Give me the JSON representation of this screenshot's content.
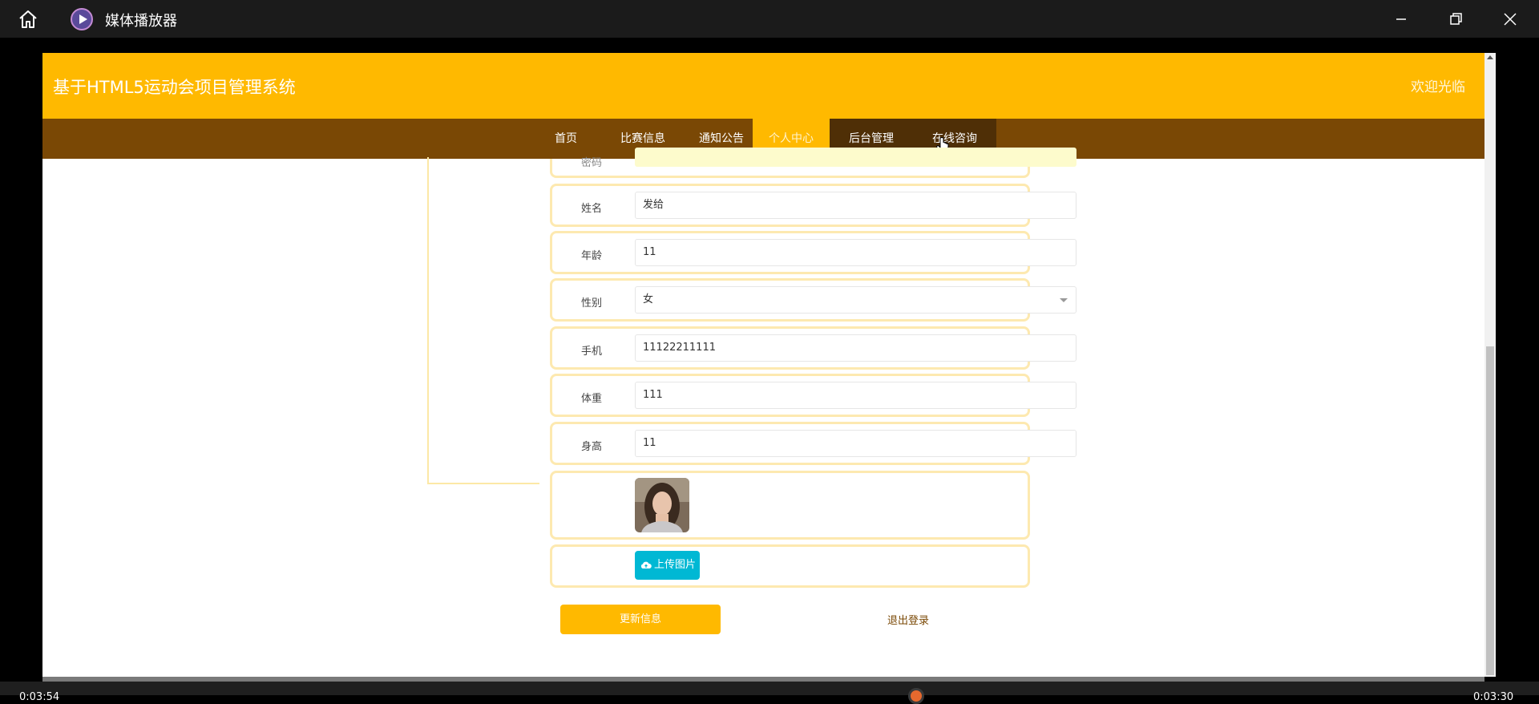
{
  "player": {
    "title": "媒体播放器",
    "time_elapsed": "0:03:54",
    "time_total": "0:03:30"
  },
  "site": {
    "title": "基于HTML5运动会项目管理系统",
    "welcome": "欢迎光临"
  },
  "nav": [
    {
      "label": "首页"
    },
    {
      "label": "比赛信息"
    },
    {
      "label": "通知公告"
    },
    {
      "label": "个人中心"
    },
    {
      "label": "后台管理"
    },
    {
      "label": "在线咨询"
    }
  ],
  "form": {
    "top_partial_label": "密码",
    "name_label": "姓名",
    "name_value": "发给",
    "age_label": "年龄",
    "age_value": "11",
    "gender_label": "性别",
    "gender_value": "女",
    "phone_label": "手机",
    "phone_value": "11122211111",
    "weight_label": "体重",
    "weight_value": "111",
    "height_label": "身高",
    "height_value": "11",
    "upload_label": "上传图片"
  },
  "actions": {
    "update_label": "更新信息",
    "logout_label": "退出登录"
  },
  "colors": {
    "header": "#ffb900",
    "nav": "#7a4805",
    "upload": "#00b8d4"
  }
}
